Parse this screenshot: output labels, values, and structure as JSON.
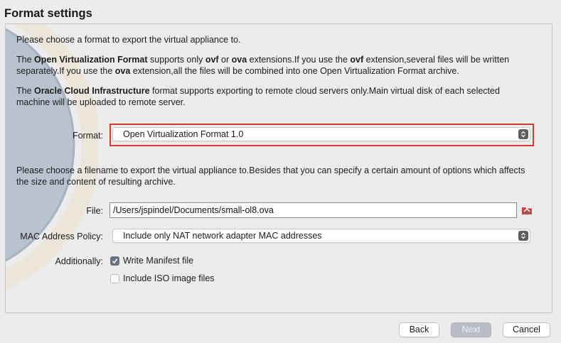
{
  "wizard": {
    "title": "Format settings"
  },
  "intro": {
    "line1": "Please choose a format to export the virtual appliance to.",
    "ovf_para": {
      "p1": "The ",
      "b1": "Open Virtualization Format",
      "p2": " supports only ",
      "b2": "ovf",
      "p3": " or ",
      "b3": "ova",
      "p4": " extensions.If you use the ",
      "b4": "ovf",
      "p5": " extension,several files will be written separately.If you use the ",
      "b5": "ova",
      "p6": " extension,all the files will be combined into one Open Virtualization Format archive."
    },
    "oci_para": {
      "p1": "The ",
      "b1": "Oracle Cloud Infrastructure",
      "p2": " format supports exporting to remote cloud servers only.Main virtual disk of each selected machine will be uploaded to remote server."
    },
    "filename_para": "Please choose a filename to export the virtual appliance to.Besides that you can specify a certain amount of options which affects the size and content of resulting archive."
  },
  "format": {
    "label": "Format:",
    "value": "Open Virtualization Format 1.0",
    "highlight_color": "#d83a2e"
  },
  "file": {
    "label": "File:",
    "value": "/Users/jspindel/Documents/small-ol8.ova",
    "browse_icon": "folder-open-icon"
  },
  "mac_policy": {
    "label": "MAC Address Policy:",
    "value": "Include only NAT network adapter MAC addresses"
  },
  "additionally": {
    "label": "Additionally:",
    "write_manifest": {
      "label": "Write Manifest file",
      "checked": true
    },
    "include_iso": {
      "label": "Include ISO image files",
      "checked": false
    }
  },
  "buttons": {
    "back": "Back",
    "next": "Next",
    "cancel": "Cancel"
  }
}
